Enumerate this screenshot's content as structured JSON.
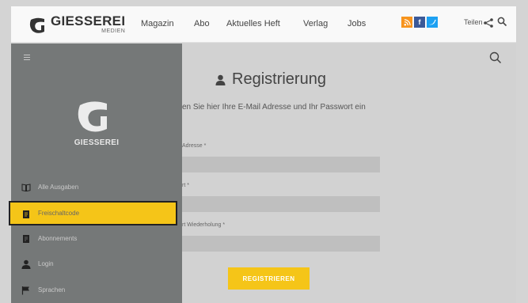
{
  "header": {
    "logo_text": "GIESSEREI",
    "logo_subtext": "MEDIEN",
    "nav": [
      "Magazin",
      "Abo",
      "Aktuelles Heft",
      "Verlag",
      "Jobs"
    ],
    "social_icons": [
      "rss-icon",
      "facebook-icon",
      "twitter-icon"
    ],
    "share_label": "Teilen"
  },
  "sidebar": {
    "brand": "GIESSEREI",
    "items": [
      {
        "label": "Alle Ausgaben",
        "icon": "book-icon"
      },
      {
        "label": "Freischaltcode",
        "icon": "code-document-icon",
        "active": true
      },
      {
        "label": "Abonnements",
        "icon": "subscription-icon"
      },
      {
        "label": "Login",
        "icon": "user-icon"
      },
      {
        "label": "Sprachen",
        "icon": "flag-icon"
      }
    ]
  },
  "registration": {
    "title": "Registrierung",
    "subtitle": "en Sie hier Ihre E-Mail Adresse und Ihr Passwort ein",
    "fields": [
      {
        "label": "Adresse *",
        "value": ""
      },
      {
        "label": "rt *",
        "value": ""
      },
      {
        "label": "rt Wiederholung *",
        "value": ""
      }
    ],
    "submit_label": "REGISTRIEREN"
  },
  "colors": {
    "accent": "#f5c518",
    "sidebar_bg": "#757878",
    "content_bg": "#d2d2d2",
    "rss": "#f7941d",
    "facebook": "#3b5998",
    "twitter": "#1da1f2"
  }
}
